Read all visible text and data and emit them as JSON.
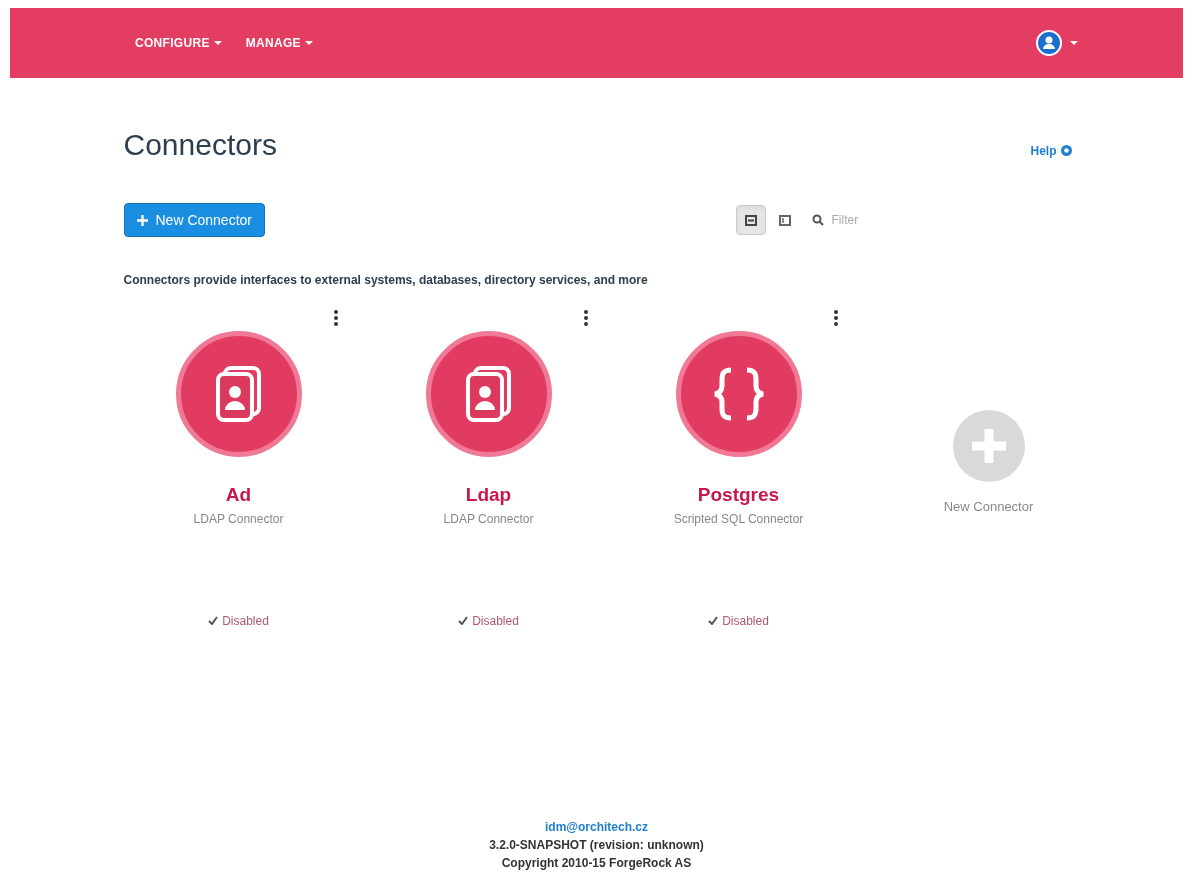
{
  "navbar": {
    "menus": [
      {
        "label": "CONFIGURE"
      },
      {
        "label": "MANAGE"
      }
    ]
  },
  "page": {
    "title": "Connectors",
    "help": "Help",
    "new_button": "New Connector",
    "views": [
      {
        "kind": "cards",
        "selected": true
      },
      {
        "kind": "list",
        "selected": false
      }
    ],
    "filter": {
      "placeholder": "Filter"
    },
    "description": "Connectors provide interfaces to external systems, databases, directory services, and more"
  },
  "connectors": [
    {
      "name": "Ad",
      "type": "LDAP Connector",
      "status": "Disabled",
      "kind": "ldap"
    },
    {
      "name": "Ldap",
      "type": "LDAP Connector",
      "status": "Disabled",
      "kind": "ldap"
    },
    {
      "name": "Postgres",
      "type": "Scripted SQL Connector",
      "status": "Disabled",
      "kind": "sql"
    }
  ],
  "add_card": {
    "label": "New Connector"
  },
  "footer": {
    "email": "idm@orchitech.cz",
    "version": "3.2.0-SNAPSHOT (revision: unknown)",
    "copyright": "Copyright 2010-15 ForgeRock AS"
  }
}
